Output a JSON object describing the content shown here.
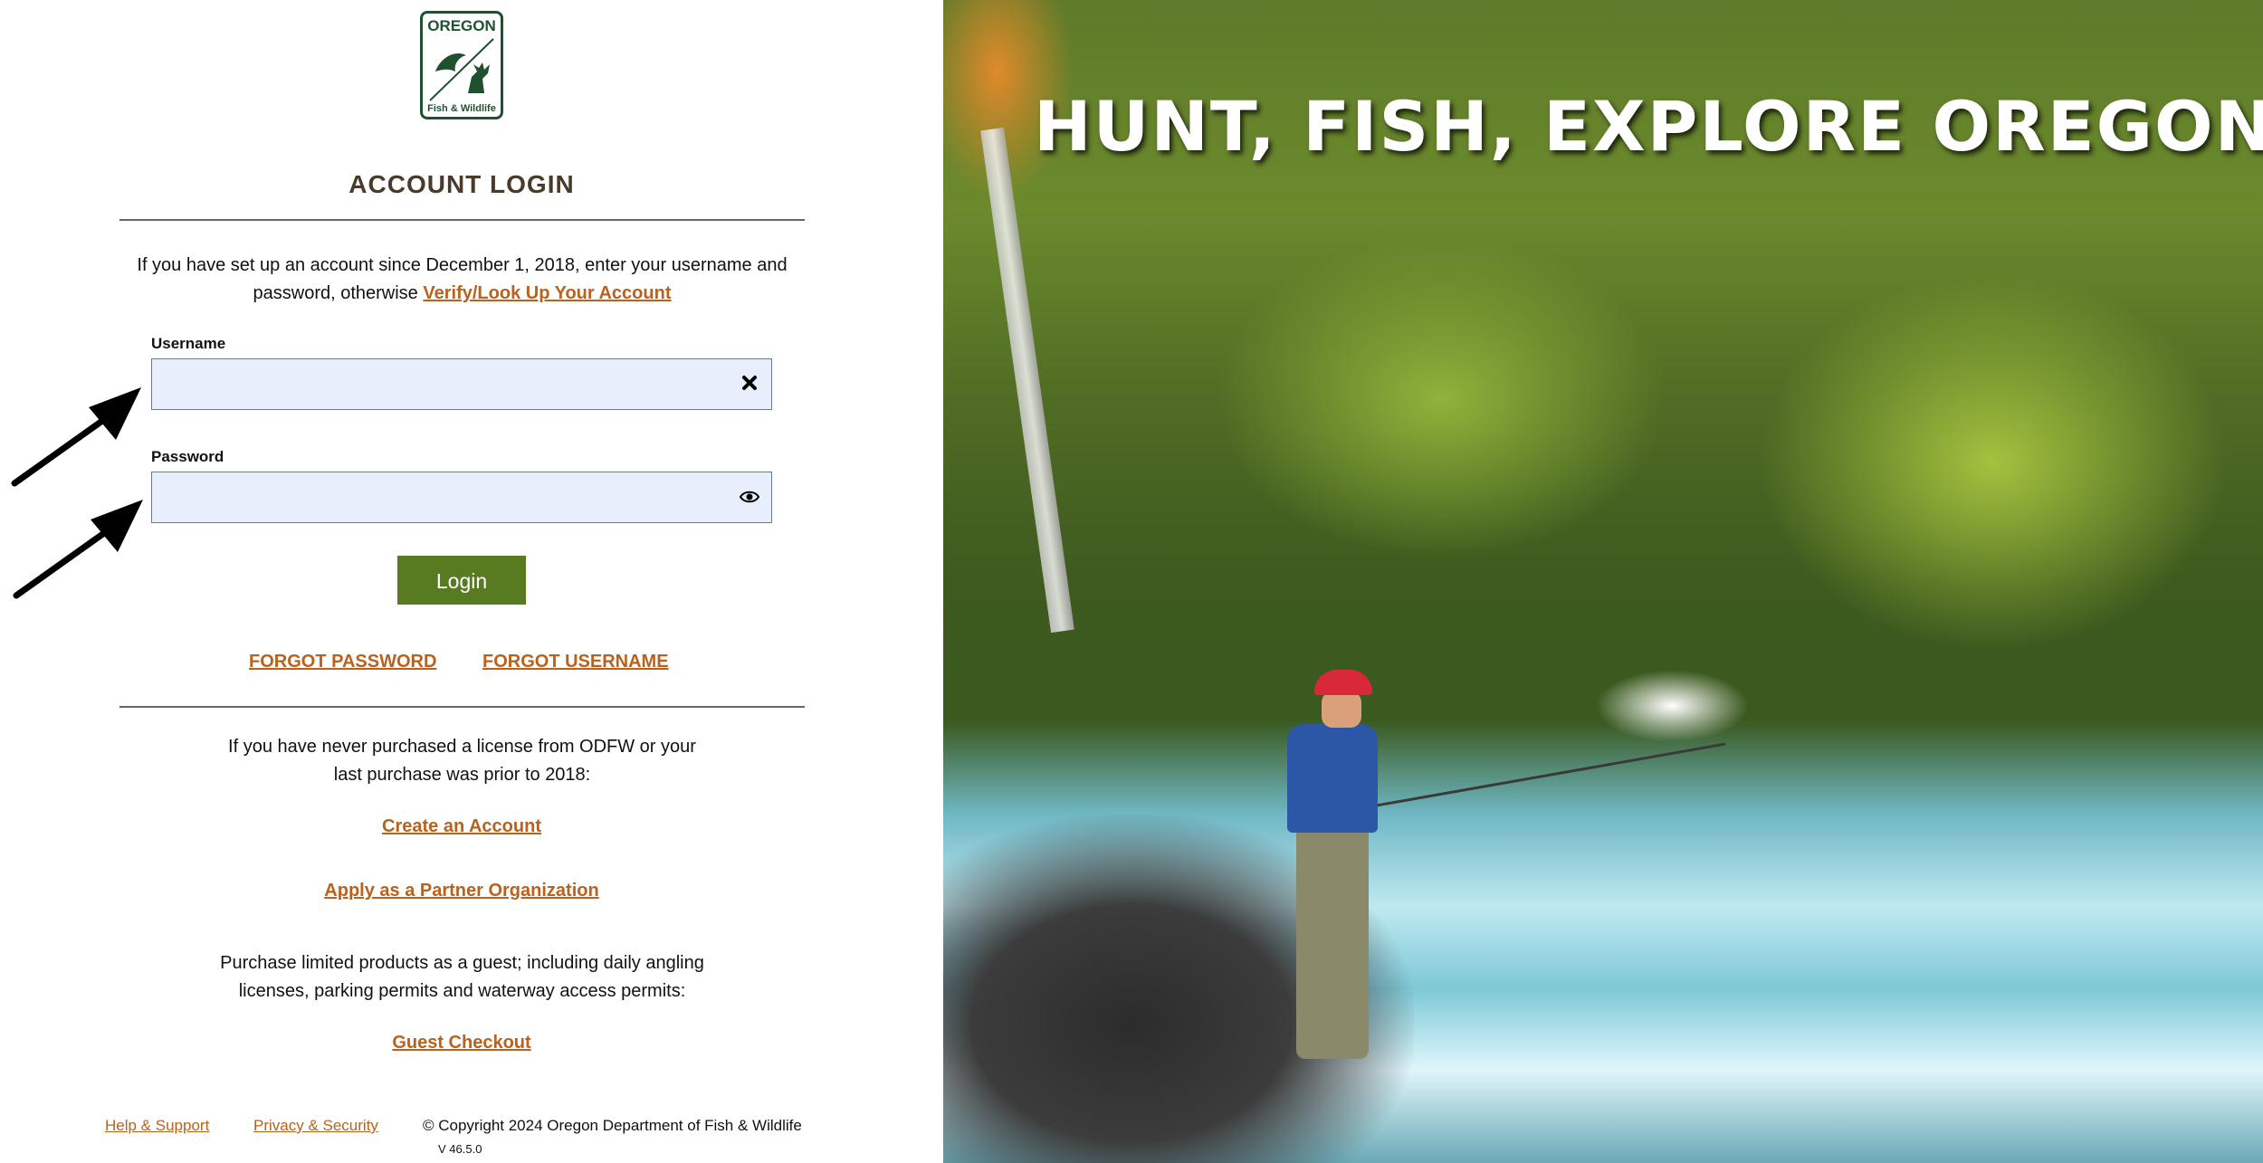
{
  "logo": {
    "top_text": "OREGON",
    "bottom_text": "Fish & Wildlife"
  },
  "login": {
    "heading": "ACCOUNT LOGIN",
    "intro_text": "If you have set up an account since December 1, 2018, enter your username and password, otherwise",
    "intro_link": "Verify/Look Up Your Account",
    "username_label": "Username",
    "username_value": "",
    "password_label": "Password",
    "password_value": "",
    "login_button": "Login",
    "forgot_password": "FORGOT PASSWORD",
    "forgot_username": "FORGOT USERNAME"
  },
  "new_user": {
    "text_line1": "If you have never purchased a license from ODFW or your",
    "text_line2": "last purchase was prior to 2018:",
    "create_account": "Create an Account",
    "partner": "Apply as a Partner Organization",
    "guest_line1": "Purchase limited products as a guest; including daily angling",
    "guest_line2": "licenses, parking permits and waterway access permits:",
    "guest_checkout": "Guest Checkout"
  },
  "footer": {
    "help": "Help & Support",
    "privacy": "Privacy & Security",
    "copyright": "© Copyright 2024 Oregon Department of Fish & Wildlife",
    "version": "V 46.5.0"
  },
  "hero": {
    "title": "HUNT, FISH, EXPLORE OREGON"
  },
  "icons": {
    "clear": "close-icon",
    "reveal": "eye-icon"
  },
  "colors": {
    "link": "#b8621e",
    "button": "#587b22",
    "input_bg": "#e7effc",
    "logo_green": "#1f5130"
  }
}
